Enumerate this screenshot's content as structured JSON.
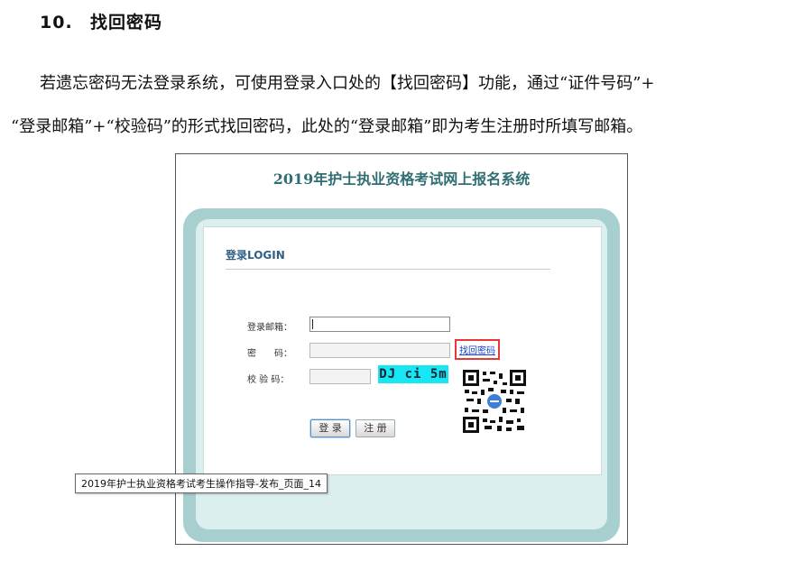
{
  "section": {
    "number": "10.",
    "title": "找回密码"
  },
  "paragraph": {
    "line1": "若遗忘密码无法登录系统，可使用登录入口处的【找回密码】功能，通过“证件号码”+",
    "line2": "“登录邮箱”+“校验码”的形式找回密码，此处的“登录邮箱”即为考生注册时所填写邮箱。"
  },
  "screenshot": {
    "system_title": "2019年护士执业资格考试网上报名系统",
    "login_title": "登录LOGIN",
    "fields": {
      "email_label": "登录邮箱：",
      "password_label": "密　　码：",
      "code_label": "校 验 码："
    },
    "forgot_link": "找回密码",
    "captcha_text": "DJ ci 5m",
    "buttons": {
      "login": "登 录",
      "register": "注 册"
    }
  },
  "tooltip": "2019年护士执业资格考试考生操作指导-发布_页面_14",
  "colors": {
    "title_teal": "#2f6f74",
    "frame_teal": "#a7cfcf",
    "highlight_red": "#e53935",
    "captcha_bg": "#17e7f2"
  }
}
